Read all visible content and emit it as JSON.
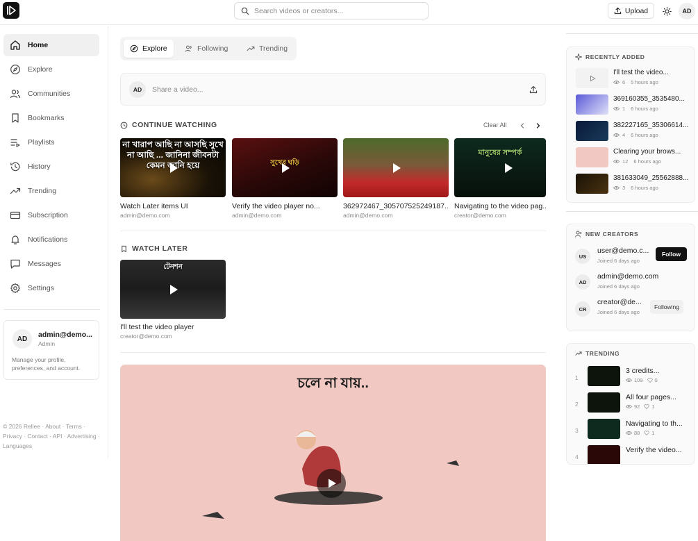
{
  "header": {
    "search_placeholder": "Search videos or creators...",
    "upload_label": "Upload",
    "avatar_initials": "AD"
  },
  "sidebar": {
    "items": [
      {
        "label": "Home",
        "icon": "home-icon",
        "active": true
      },
      {
        "label": "Explore",
        "icon": "compass-icon"
      },
      {
        "label": "Communities",
        "icon": "users-icon"
      },
      {
        "label": "Bookmarks",
        "icon": "bookmark-icon"
      },
      {
        "label": "Playlists",
        "icon": "playlist-icon"
      },
      {
        "label": "History",
        "icon": "history-icon"
      },
      {
        "label": "Trending",
        "icon": "trending-icon"
      },
      {
        "label": "Subscription",
        "icon": "card-icon"
      },
      {
        "label": "Notifications",
        "icon": "bell-icon"
      },
      {
        "label": "Messages",
        "icon": "message-icon"
      },
      {
        "label": "Settings",
        "icon": "gear-icon"
      }
    ],
    "profile": {
      "initials": "AD",
      "name": "admin@demo...",
      "role": "Admin",
      "description": "Manage your profile, preferences, and account."
    },
    "footer": "© 2026 Rellee · About · Terms · Privacy · Contact · API · Advertising · Languages"
  },
  "main": {
    "tabs": [
      {
        "label": "Explore",
        "icon": "compass-icon",
        "active": true
      },
      {
        "label": "Following",
        "icon": "users-icon"
      },
      {
        "label": "Trending",
        "icon": "trending-icon"
      }
    ],
    "composer": {
      "initials": "AD",
      "placeholder": "Share a video..."
    },
    "continue_watching": {
      "title": "CONTINUE WATCHING",
      "clear_label": "Clear All",
      "videos": [
        {
          "title": "Watch Later items UI",
          "author": "admin@demo.com",
          "overlay": "না খারাপ আছি না আসছি সুখে না আছি ... জানিনা জীবনটা কেমন জানি হয়ে"
        },
        {
          "title": "Verify the video player no...",
          "author": "admin@demo.com",
          "overlay": "সুখের ঘড়ি"
        },
        {
          "title": "362972467_305707525249187...",
          "author": "admin@demo.com",
          "overlay": ""
        },
        {
          "title": "Navigating to the video pag...",
          "author": "creator@demo.com",
          "overlay": "মানুষের সম্পর্ক"
        }
      ]
    },
    "watch_later": {
      "title": "WATCH LATER",
      "videos": [
        {
          "title": "I'll test the video player",
          "author": "creator@demo.com",
          "overlay": "টেনশন"
        }
      ]
    },
    "featured": {
      "caption": "চলে না যায়.."
    }
  },
  "right_panel": {
    "recently_added": {
      "title": "RECENTLY ADDED",
      "items": [
        {
          "title": "I'll test the video...",
          "views": "6",
          "time": "5 hours ago"
        },
        {
          "title": "369160355_3535480...",
          "views": "1",
          "time": "6 hours ago"
        },
        {
          "title": "382227165_35306614...",
          "views": "4",
          "time": "6 hours ago"
        },
        {
          "title": "Clearing your brows...",
          "views": "12",
          "time": "6 hours ago"
        },
        {
          "title": "381633049_25562888...",
          "views": "3",
          "time": "6 hours ago"
        }
      ]
    },
    "new_creators": {
      "title": "NEW CREATORS",
      "items": [
        {
          "initials": "US",
          "name": "user@demo.c...",
          "joined": "Joined 6 days ago",
          "button": "Follow"
        },
        {
          "initials": "AD",
          "name": "admin@demo.com",
          "joined": "Joined 6 days ago",
          "button": ""
        },
        {
          "initials": "CR",
          "name": "creator@de...",
          "joined": "Joined 6 days ago",
          "button": "Following"
        }
      ]
    },
    "trending": {
      "title": "TRENDING",
      "items": [
        {
          "rank": "1",
          "title": "3 credits...",
          "views": "109",
          "likes": "0"
        },
        {
          "rank": "2",
          "title": "All four pages...",
          "views": "92",
          "likes": "1"
        },
        {
          "rank": "3",
          "title": "Navigating to th...",
          "views": "88",
          "likes": "1"
        },
        {
          "rank": "4",
          "title": "Verify the video...",
          "views": "",
          "likes": ""
        }
      ]
    }
  },
  "colors": {
    "accent": "#111111",
    "muted": "#8a8a8a",
    "border": "#ececec",
    "featured_bg": "#f2c8c2"
  }
}
